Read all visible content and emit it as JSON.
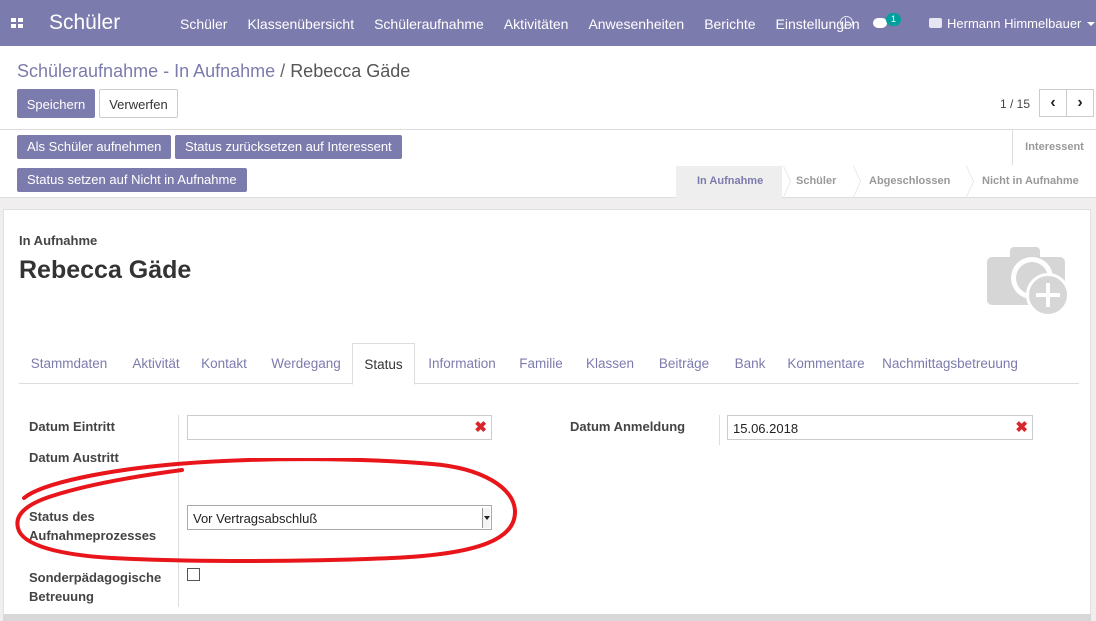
{
  "topbar": {
    "brand": "Schüler",
    "menu": [
      "Schüler",
      "Klassenübersicht",
      "Schüleraufnahme",
      "Aktivitäten",
      "Anwesenheiten",
      "Berichte",
      "Einstellungen"
    ],
    "chat_badge": "1",
    "user_name": "Hermann Himmelbauer"
  },
  "breadcrumb": {
    "link": "Schüleraufnahme - In Aufnahme",
    "separator": "/",
    "current": "Rebecca Gäde"
  },
  "buttons": {
    "save": "Speichern",
    "discard": "Verwerfen"
  },
  "pager": {
    "value": "1 / 15"
  },
  "status_buttons": {
    "accept": "Als Schüler aufnehmen",
    "reset": "Status zurücksetzen auf Interessent",
    "not_admitted": "Status setzen auf Nicht in Aufnahme"
  },
  "stages": {
    "interessent": "Interessent",
    "items": [
      "In Aufnahme",
      "Schüler",
      "Abgeschlossen",
      "Nicht in Aufnahme"
    ]
  },
  "record": {
    "status": "In Aufnahme",
    "name": "Rebecca Gäde"
  },
  "tabs": [
    "Stammdaten",
    "Aktivität",
    "Kontakt",
    "Werdegang",
    "Status",
    "Information",
    "Familie",
    "Klassen",
    "Beiträge",
    "Bank",
    "Kommentare",
    "Nachmittagsbetreuung"
  ],
  "fields": {
    "eintritt_label": "Datum Eintritt",
    "eintritt_value": "",
    "austritt_label": "Datum Austritt",
    "anmeldung_label": "Datum Anmeldung",
    "anmeldung_value": "15.06.2018",
    "prozess_label_1": "Status des",
    "prozess_label_2": "Aufnahmeprozesses",
    "prozess_value": "Vor Vertragsabschluß",
    "sonder_label_1": "Sonderpädagogische",
    "sonder_label_2": "Betreuung"
  },
  "colors": {
    "brand": "#7c7bad",
    "annotation": "#e8151b",
    "remove": "#d9262b"
  }
}
